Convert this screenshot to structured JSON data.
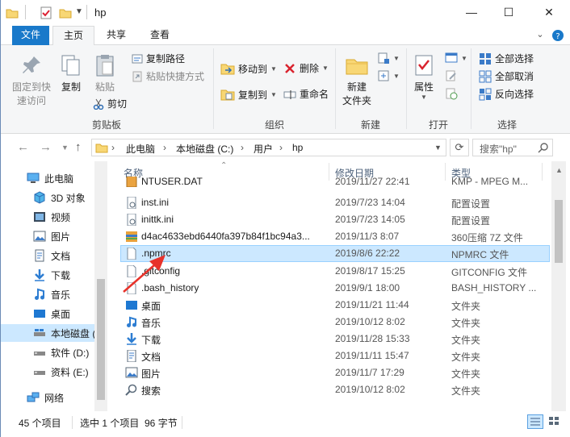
{
  "window": {
    "title": "hp",
    "controls": {
      "minimize": "—",
      "maximize": "☐",
      "close": "✕"
    }
  },
  "ribbon_tabs": [
    {
      "label": "文件",
      "kind": "file"
    },
    {
      "label": "主页",
      "kind": "active"
    },
    {
      "label": "共享",
      "kind": "normal"
    },
    {
      "label": "查看",
      "kind": "normal"
    }
  ],
  "ribbon": {
    "pin_label_1": "固定到快",
    "pin_label_2": "速访问",
    "copy": "复制",
    "paste": "粘贴",
    "copy_path": "复制路径",
    "paste_shortcut": "粘贴快捷方式",
    "cut": "剪切",
    "group_clipboard": "剪贴板",
    "move_to": "移动到",
    "copy_to": "复制到",
    "delete": "删除",
    "rename": "重命名",
    "group_organize": "组织",
    "new_folder_1": "新建",
    "new_folder_2": "文件夹",
    "group_new": "新建",
    "properties": "属性",
    "group_open": "打开",
    "select_all": "全部选择",
    "select_none": "全部取消",
    "invert_selection": "反向选择",
    "group_select": "选择"
  },
  "address": {
    "crumbs": [
      "此电脑",
      "本地磁盘 (C:)",
      "用户",
      "hp"
    ],
    "search_placeholder": "搜索\"hp\""
  },
  "nav_pane": [
    {
      "label": "此电脑",
      "icon": "pc-icon",
      "selected": false
    },
    {
      "label": "3D 对象",
      "icon": "cube-icon",
      "selected": false
    },
    {
      "label": "视频",
      "icon": "video-icon",
      "selected": false
    },
    {
      "label": "图片",
      "icon": "picture-icon",
      "selected": false
    },
    {
      "label": "文档",
      "icon": "document-icon",
      "selected": false
    },
    {
      "label": "下载",
      "icon": "download-icon",
      "selected": false
    },
    {
      "label": "音乐",
      "icon": "music-icon",
      "selected": false
    },
    {
      "label": "桌面",
      "icon": "desktop-icon",
      "selected": false
    },
    {
      "label": "本地磁盘 (",
      "icon": "drive-icon",
      "selected": true
    },
    {
      "label": "软件 (D:)",
      "icon": "drive-icon",
      "selected": false
    },
    {
      "label": "资料 (E:)",
      "icon": "drive-icon",
      "selected": false
    },
    {
      "label": "网络",
      "icon": "network-icon",
      "selected": false
    }
  ],
  "columns": {
    "name": "名称",
    "date": "修改日期",
    "type": "类型"
  },
  "files": [
    {
      "name": "NTUSER.DAT",
      "date": "2019/11/27 22:41",
      "type": "KMP - MPEG M...",
      "icon": "dat-file-icon",
      "selected": false
    },
    {
      "name": "inst.ini",
      "date": "2019/7/23 14:04",
      "type": "配置设置",
      "icon": "ini-file-icon",
      "selected": false
    },
    {
      "name": "inittk.ini",
      "date": "2019/7/23 14:05",
      "type": "配置设置",
      "icon": "ini-file-icon",
      "selected": false
    },
    {
      "name": "d4ac4633ebd6440fa397b84f1bc94a3...",
      "date": "2019/11/3 8:07",
      "type": "360压缩 7Z 文件",
      "icon": "archive-icon",
      "selected": false
    },
    {
      "name": ".npmrc",
      "date": "2019/8/6 22:22",
      "type": "NPMRC 文件",
      "icon": "blank-file-icon",
      "selected": true
    },
    {
      "name": ".gitconfig",
      "date": "2019/8/17 15:25",
      "type": "GITCONFIG 文件",
      "icon": "blank-file-icon",
      "selected": false
    },
    {
      "name": ".bash_history",
      "date": "2019/9/1 18:00",
      "type": "BASH_HISTORY ...",
      "icon": "blank-file-icon",
      "selected": false
    },
    {
      "name": "桌面",
      "date": "2019/11/21 11:44",
      "type": "文件夹",
      "icon": "desktop-folder-icon",
      "selected": false
    },
    {
      "name": "音乐",
      "date": "2019/10/12 8:02",
      "type": "文件夹",
      "icon": "music-folder-icon",
      "selected": false
    },
    {
      "name": "下载",
      "date": "2019/11/28 15:33",
      "type": "文件夹",
      "icon": "download-folder-icon",
      "selected": false
    },
    {
      "name": "文档",
      "date": "2019/11/11 15:47",
      "type": "文件夹",
      "icon": "document-folder-icon",
      "selected": false
    },
    {
      "name": "图片",
      "date": "2019/11/7 17:29",
      "type": "文件夹",
      "icon": "picture-folder-icon",
      "selected": false
    },
    {
      "name": "搜索",
      "date": "2019/10/12 8:02",
      "type": "文件夹",
      "icon": "search-folder-icon",
      "selected": false
    }
  ],
  "status": {
    "item_count": "45 个项目",
    "selection": "选中 1 个项目  96 字节"
  },
  "colors": {
    "accent": "#1979ca",
    "selection": "#cce8ff",
    "annotation_arrow": "#e8322a"
  }
}
